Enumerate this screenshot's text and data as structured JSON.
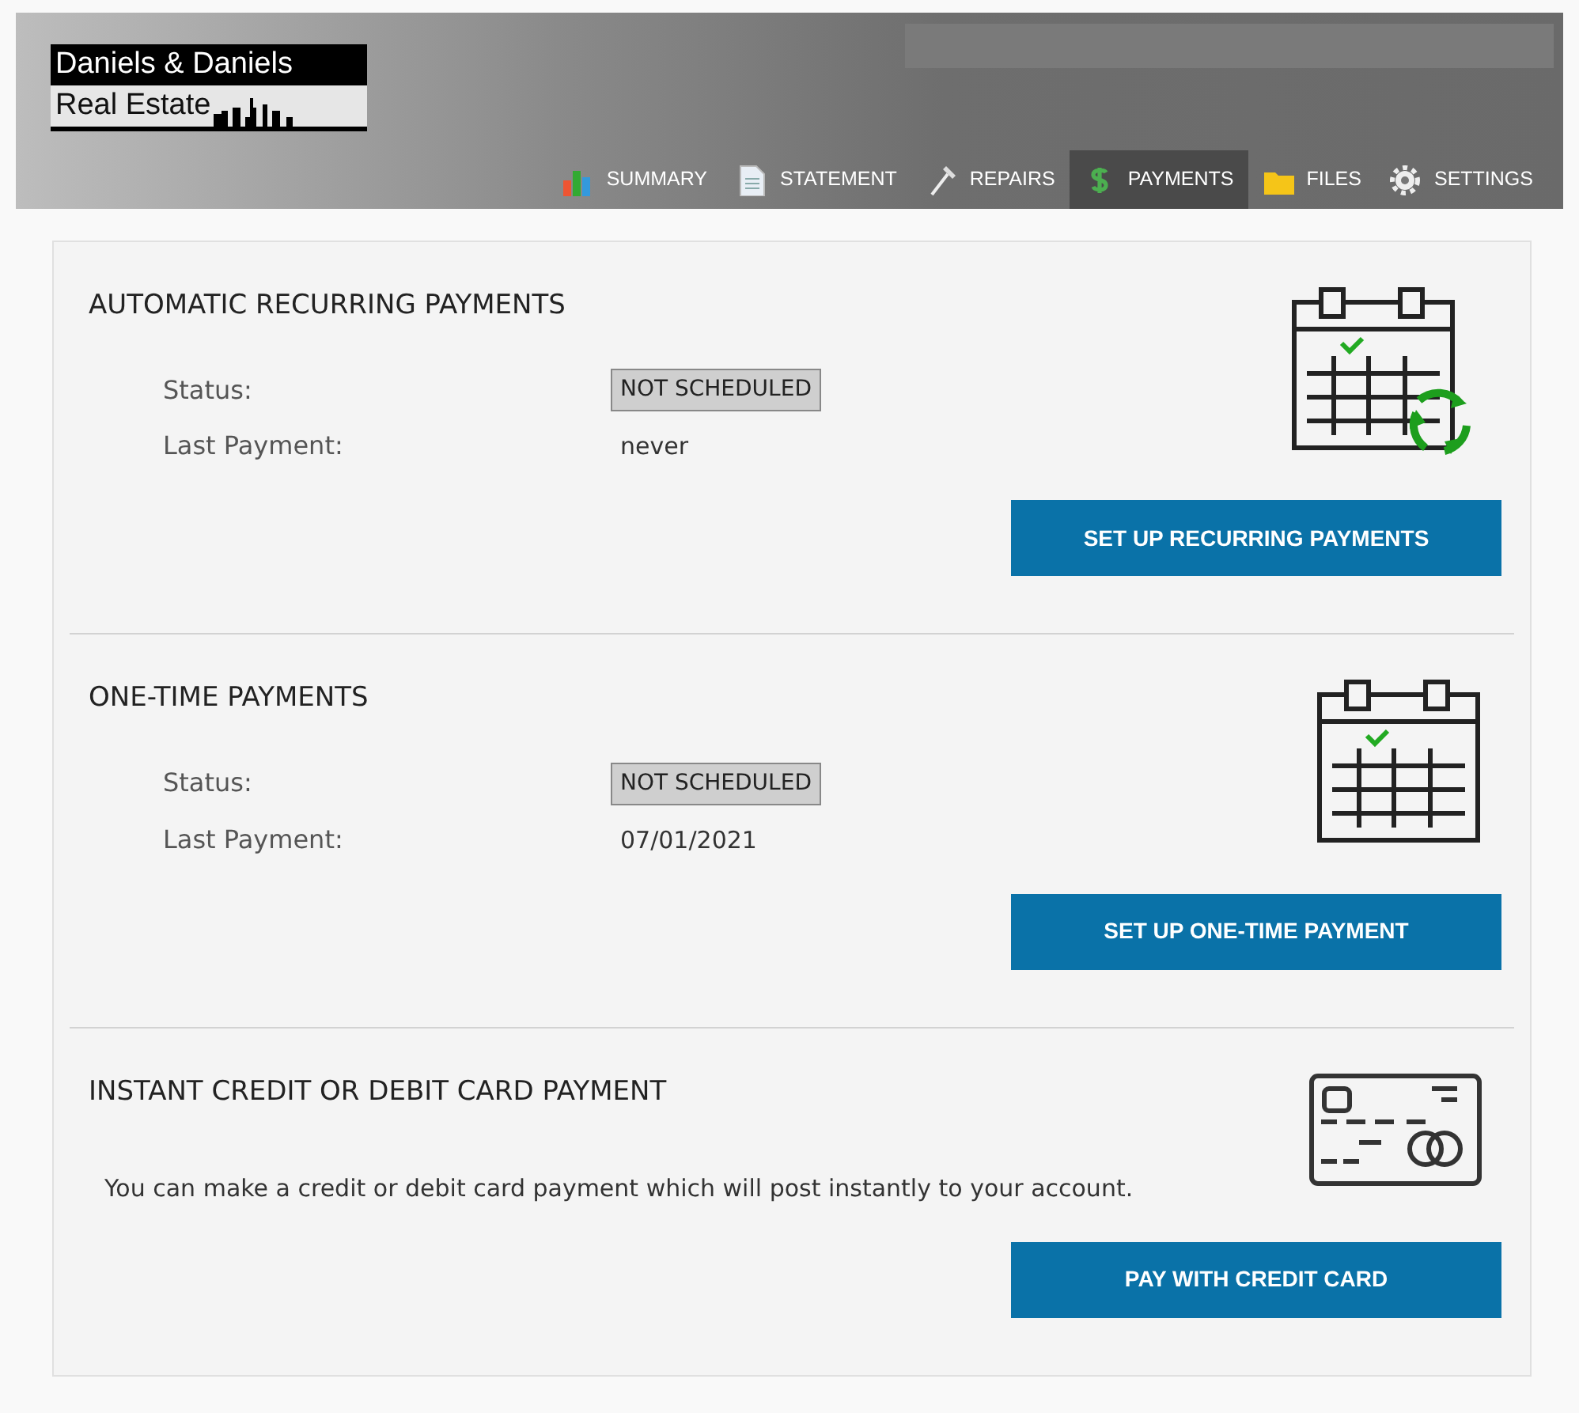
{
  "header": {
    "logo": {
      "line_1": "Daniels & Daniels",
      "line_2": "Real Estate"
    },
    "nav": [
      {
        "label": "SUMMARY",
        "kind": "chart",
        "selected": false
      },
      {
        "label": "STATEMENT",
        "kind": "document",
        "selected": false
      },
      {
        "label": "REPAIRS",
        "kind": "hammer",
        "selected": false
      },
      {
        "label": "PAYMENTS",
        "kind": "dollar",
        "selected": true
      },
      {
        "label": "FILES",
        "kind": "folder",
        "selected": false
      },
      {
        "label": "SETTINGS",
        "kind": "gear",
        "selected": false
      }
    ]
  },
  "sections": [
    {
      "kind": "recurring",
      "title": "AUTOMATIC RECURRING PAYMENTS",
      "rows": [
        {
          "label": "Status:",
          "value": "NOT SCHEDULED",
          "kind": "badge"
        },
        {
          "label": "Last Payment:",
          "value": "never",
          "kind": "text"
        }
      ],
      "button": "SET UP RECURRING PAYMENTS"
    },
    {
      "kind": "onetime",
      "title": "ONE-TIME PAYMENTS",
      "rows": [
        {
          "label": "Status:",
          "value": "NOT SCHEDULED",
          "kind": "badge"
        },
        {
          "label": "Last Payment:",
          "value": "07/01/2021",
          "kind": "text"
        }
      ],
      "button": "SET UP ONE-TIME PAYMENT"
    },
    {
      "kind": "card",
      "title": "INSTANT CREDIT OR DEBIT CARD PAYMENT",
      "description": "You can make a credit or debit card payment which will post instantly to your account.",
      "button": "PAY WITH CREDIT CARD"
    }
  ]
}
